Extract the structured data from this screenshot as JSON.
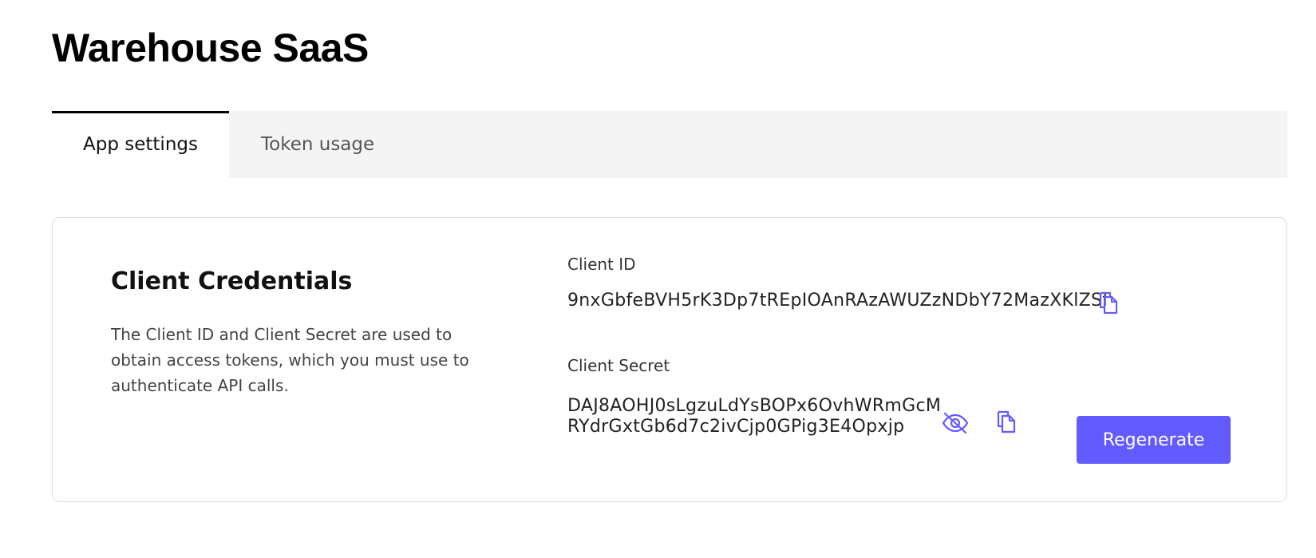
{
  "app": {
    "title": "Warehouse SaaS"
  },
  "tabs": [
    {
      "label": "App settings",
      "active": true
    },
    {
      "label": "Token usage",
      "active": false
    }
  ],
  "credentials": {
    "title": "Client Credentials",
    "description": "The Client ID and Client Secret are used to obtain access tokens, which you must use to authenticate API calls.",
    "client_id": {
      "label": "Client ID",
      "value": "9nxGbfeBVH5rK3Dp7tREpIOAnRAzAWUZzNDbY72MazXKlZSf",
      "copy_icon": "copy-icon"
    },
    "client_secret": {
      "label": "Client Secret",
      "value_line1": "DAJ8AOHJ0sLgzuLdYsBOPx6OvhWRmGcM",
      "value_line2": "RYdrGxtGb6d7c2ivCjp0GPig3E4Opxjp",
      "visibility_icon": "eye-off-icon",
      "copy_icon": "copy-icon"
    },
    "regenerate_label": "Regenerate"
  },
  "colors": {
    "accent": "#635bff",
    "icon": "#635bff",
    "tab_bar": "#f4f4f4",
    "card_border": "#dcdcdc"
  }
}
